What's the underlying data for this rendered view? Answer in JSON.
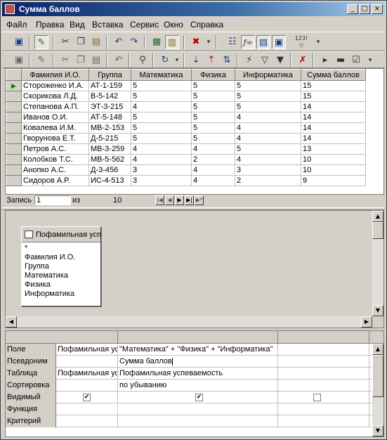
{
  "window": {
    "title": "Сумма баллов",
    "controls": {
      "minimize": "_",
      "maximize": "□",
      "close": "×"
    }
  },
  "menu": [
    {
      "label": "Файл",
      "u": "Ф"
    },
    {
      "label": "Правка",
      "u": "П"
    },
    {
      "label": "Вид",
      "u": "В"
    },
    {
      "label": "Вставка",
      "u": "а"
    },
    {
      "label": "Сервис",
      "u": "С"
    },
    {
      "label": "Окно",
      "u": "О"
    },
    {
      "label": "Справка",
      "u": "С"
    }
  ],
  "toolbar1": {
    "items": [
      "save-icon",
      "design-view-icon",
      "cut-icon",
      "copy-icon",
      "paste-icon",
      "undo-icon",
      "redo-icon",
      "query-type-icon",
      "show-table-icon",
      "delete-icon",
      "dropdown-icon",
      "properties-icon",
      "totals-icon",
      "builder-icon",
      "database-window-icon",
      "top-values-icon",
      "more-icon"
    ],
    "top_values_label": "123!"
  },
  "toolbar2": {
    "items": [
      "save-record-icon",
      "edit-icon",
      "cut-icon",
      "copy-icon",
      "paste-icon",
      "undo-icon",
      "find-icon",
      "spelling-icon",
      "sort-asc-icon",
      "sort-desc-icon",
      "filter-by-selection-icon",
      "filter-by-form-icon",
      "apply-filter-icon",
      "new-record-icon",
      "delete-record-icon",
      "properties-icon"
    ]
  },
  "datasheet": {
    "columns": [
      "Фамилия И.О.",
      "Группа",
      "Математика",
      "Физика",
      "Информатика",
      "Сумма баллов"
    ],
    "rows": [
      [
        "Стороженко И.А.",
        "АТ-1-159",
        "5",
        "5",
        "5",
        "15"
      ],
      [
        "Скорикова Л.Д.",
        "В-5-142",
        "5",
        "5",
        "5",
        "15"
      ],
      [
        "Степанова А.П.",
        "ЭТ-3-215",
        "4",
        "5",
        "5",
        "14"
      ],
      [
        "Иванов О.И.",
        "АТ-5-148",
        "5",
        "5",
        "4",
        "14"
      ],
      [
        "Ковалева И.М.",
        "МВ-2-153",
        "5",
        "5",
        "4",
        "14"
      ],
      [
        "Гворунова Е.Т.",
        "Д-5-215",
        "5",
        "5",
        "4",
        "14"
      ],
      [
        "Петров А.С.",
        "МВ-3-259",
        "4",
        "4",
        "5",
        "13"
      ],
      [
        "Колобков Т.С.",
        "МВ-5-562",
        "4",
        "2",
        "4",
        "10"
      ],
      [
        "Анопко А.С.",
        "Д-3-456",
        "3",
        "4",
        "3",
        "10"
      ],
      [
        "Сидоров А.Р.",
        "ИС-4-513",
        "3",
        "4",
        "2",
        "9"
      ]
    ],
    "current_row_marker": "▶"
  },
  "navigation": {
    "record_label": "Запись",
    "current_record": "1",
    "of_label": "из",
    "total_records": "10"
  },
  "query_design": {
    "field_list": {
      "table_name": "Пофамильная успеваемость",
      "fields": [
        "*",
        "Фамилия И.О.",
        "Группа",
        "Математика",
        "Физика",
        "Информатика"
      ]
    },
    "grid": {
      "row_labels": [
        "Поле",
        "Псевдоним",
        "Таблица",
        "Сортировка",
        "Видимый",
        "Функция",
        "Критерий"
      ],
      "col1": {
        "field": "Пофамильная успеваемость.*",
        "table": "Пофамильная успеваемость",
        "visible": true
      },
      "col2": {
        "field": "\"Математика\" + \"Физика\" + \"Информатика\"",
        "alias": "Сумма баллов",
        "table": "Пофамильная успеваемость",
        "sort": "по убыванию",
        "visible": true
      },
      "col3": {
        "visible": false
      }
    }
  }
}
